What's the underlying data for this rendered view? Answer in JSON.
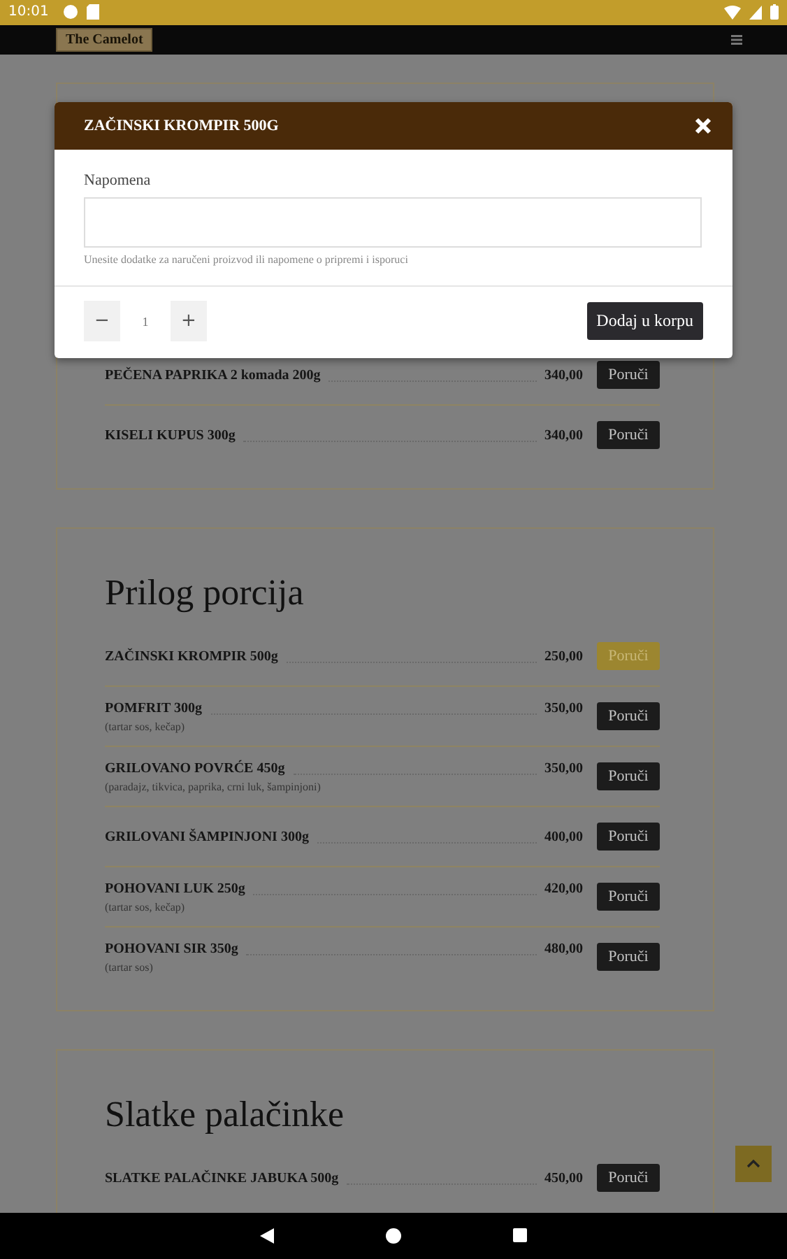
{
  "status_bar": {
    "time": "10:01"
  },
  "header": {
    "logo": "The Camelot"
  },
  "sections": [
    {
      "items": [
        {
          "name": "PEČENA PAPRIKA 2 komada 200g",
          "price": "340,00",
          "button": "Poruči",
          "selected": false
        },
        {
          "name": "KISELI KUPUS 300g",
          "price": "340,00",
          "button": "Poruči",
          "selected": false
        }
      ]
    },
    {
      "title": "Prilog porcija",
      "items": [
        {
          "name": "ZAČINSKI KROMPIR 500g",
          "price": "250,00",
          "button": "Poruči",
          "selected": true
        },
        {
          "name": "POMFRIT 300g",
          "note": "(tartar sos, kečap)",
          "price": "350,00",
          "button": "Poruči",
          "selected": false
        },
        {
          "name": "GRILOVANO POVRĆE 450g",
          "note": "(paradajz, tikvica, paprika, crni luk, šampinjoni)",
          "price": "350,00",
          "button": "Poruči",
          "selected": false
        },
        {
          "name": "GRILOVANI ŠAMPINJONI 300g",
          "price": "400,00",
          "button": "Poruči",
          "selected": false
        },
        {
          "name": "POHOVANI LUK 250g",
          "note": "(tartar sos, kečap)",
          "price": "420,00",
          "button": "Poruči",
          "selected": false
        },
        {
          "name": "POHOVANI SIR 350g",
          "note": "(tartar sos)",
          "price": "480,00",
          "button": "Poruči",
          "selected": false
        }
      ]
    },
    {
      "title": "Slatke palačinke",
      "items": [
        {
          "name": "SLATKE PALAČINKE JABUKA 500g",
          "price": "450,00",
          "button": "Poruči",
          "selected": false
        }
      ]
    }
  ],
  "modal": {
    "title": "ZAČINSKI KROMPIR 500G",
    "field_label": "Napomena",
    "help": "Unesite dodatke za naručeni proizvod ili napomene o pripremi i isporuci",
    "minus": "−",
    "quantity": "1",
    "plus": "+",
    "submit": "Dodaj u korpu"
  }
}
